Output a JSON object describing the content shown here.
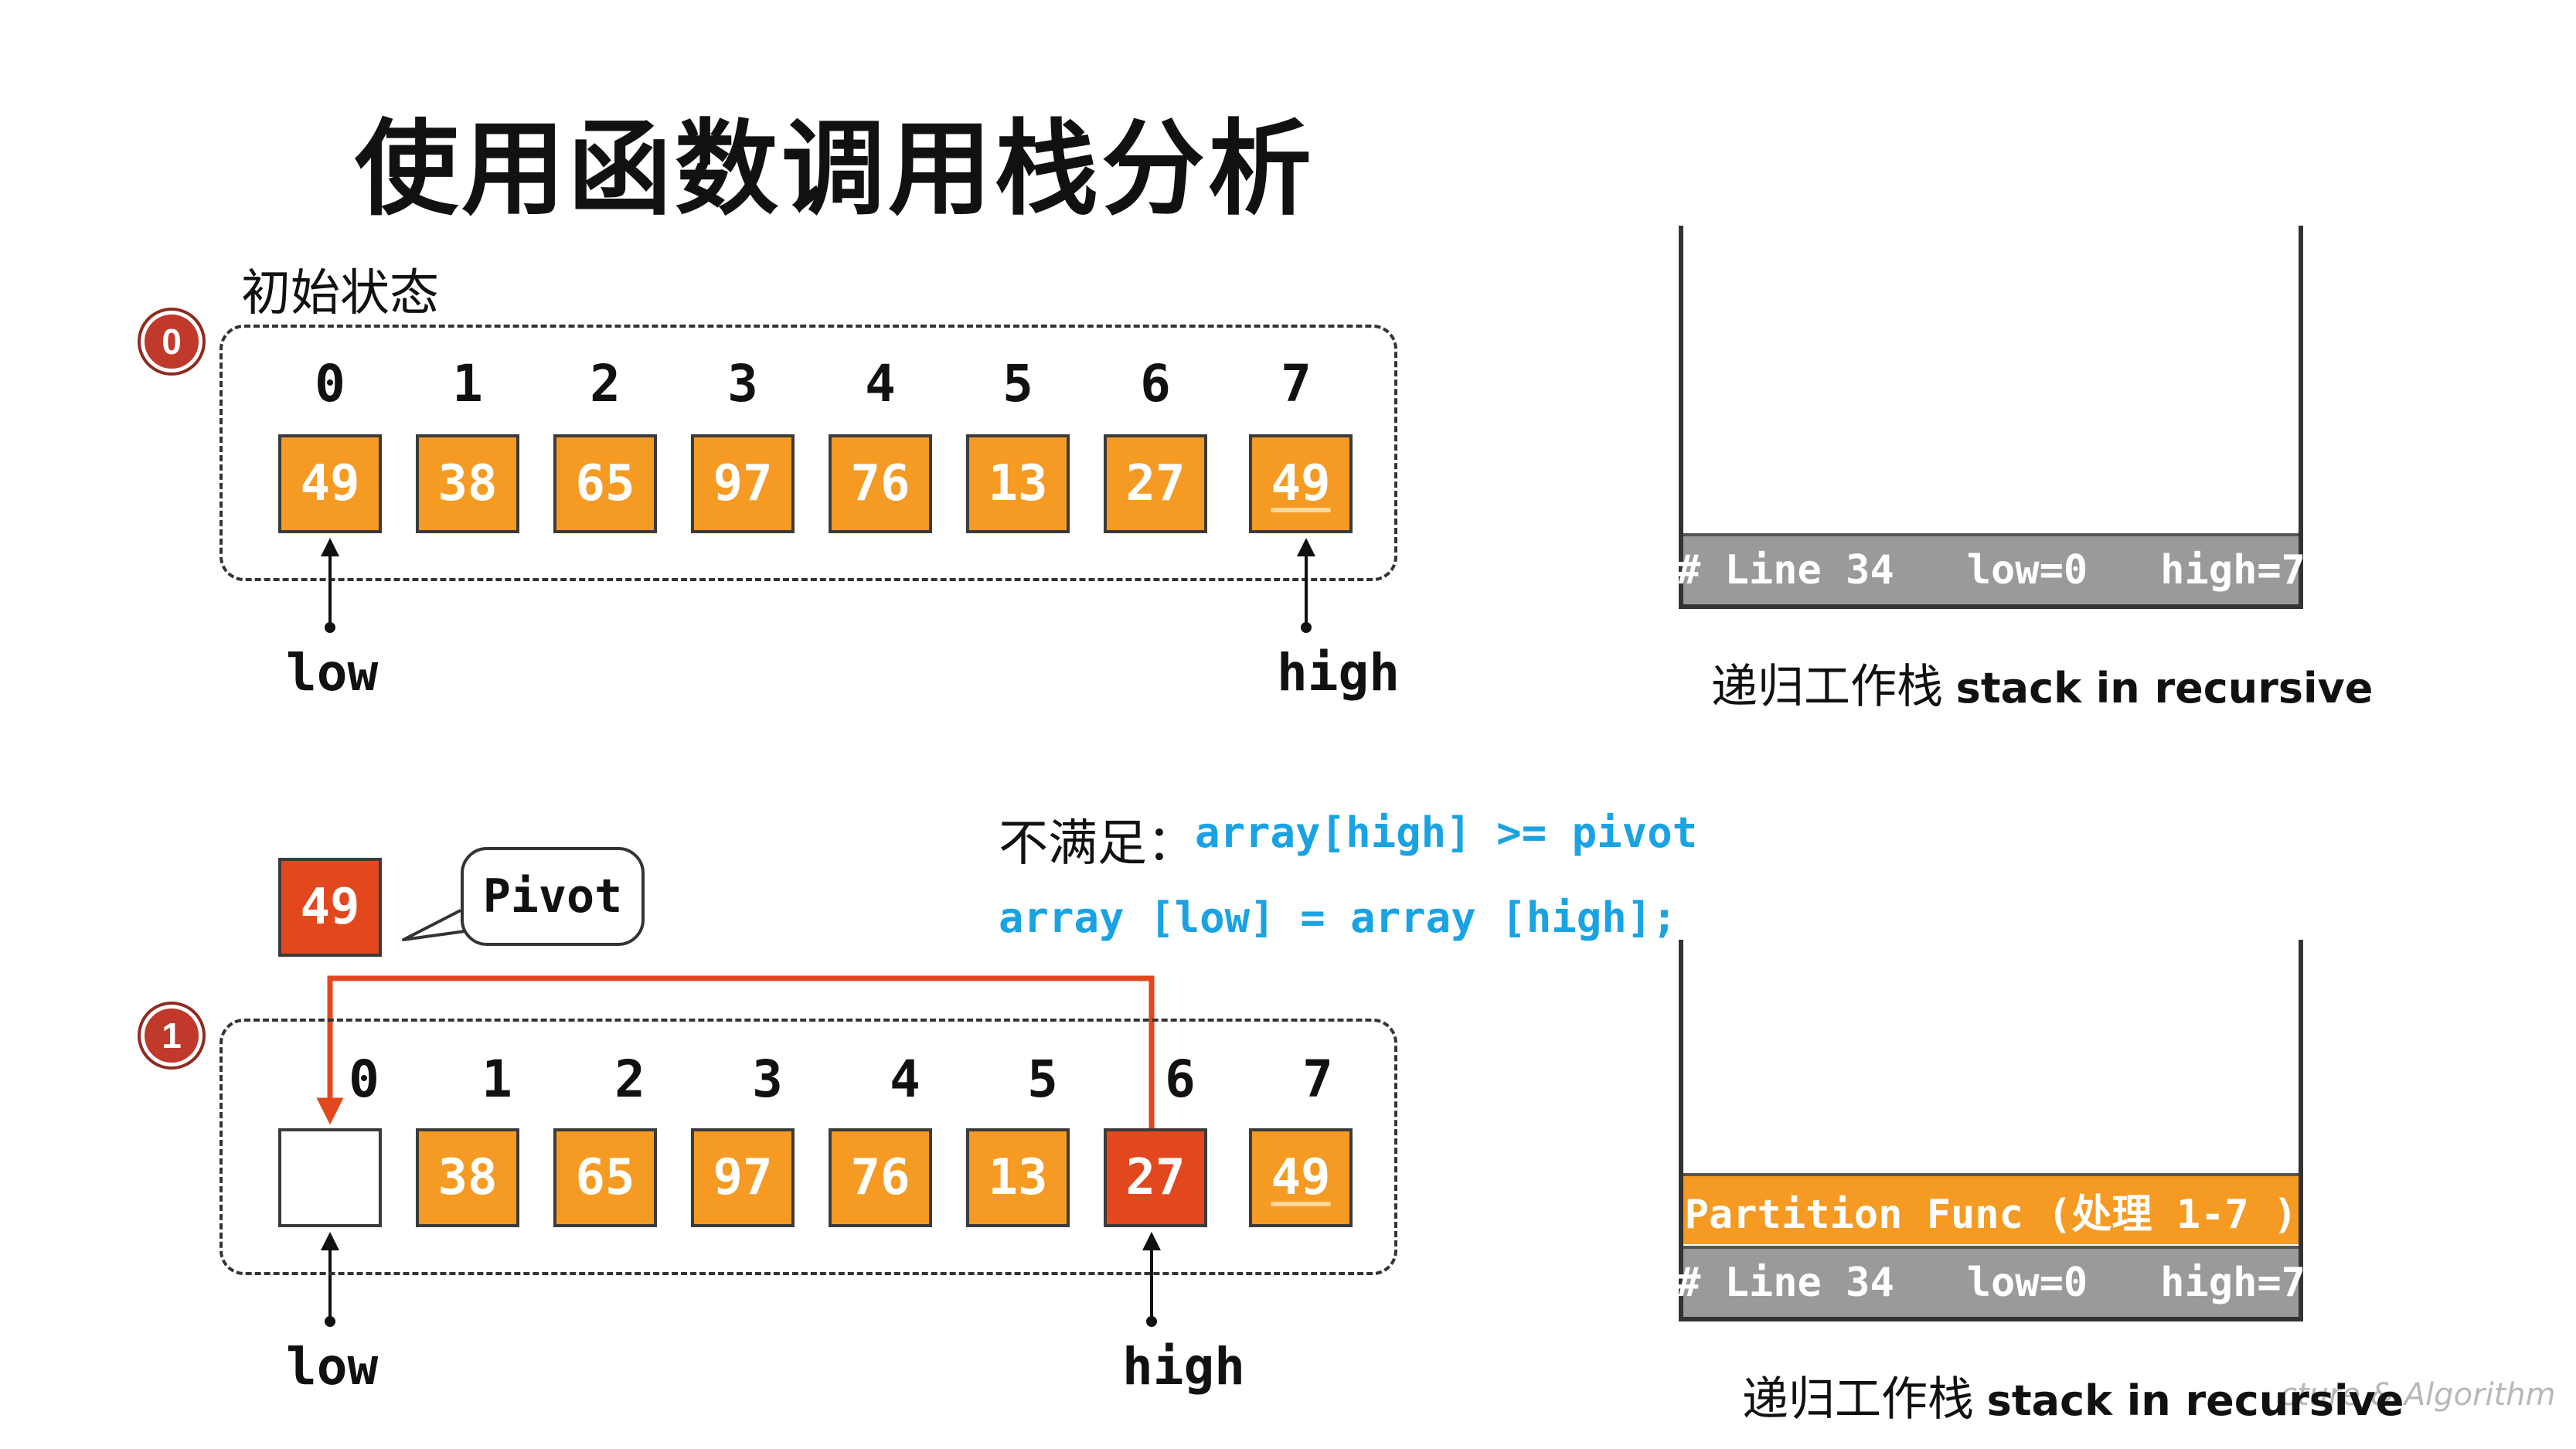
{
  "title": "使用函数调用栈分析",
  "initial_label": "初始状态",
  "panels": [
    {
      "step": "0",
      "indices": [
        "0",
        "1",
        "2",
        "3",
        "4",
        "5",
        "6",
        "7"
      ],
      "cells": [
        {
          "value": "49",
          "style": "orange"
        },
        {
          "value": "38",
          "style": "orange"
        },
        {
          "value": "65",
          "style": "orange"
        },
        {
          "value": "97",
          "style": "orange"
        },
        {
          "value": "76",
          "style": "orange"
        },
        {
          "value": "13",
          "style": "orange"
        },
        {
          "value": "27",
          "style": "orange"
        },
        {
          "value": "49",
          "style": "orange"
        }
      ],
      "low_label": "low",
      "high_label": "high"
    },
    {
      "step": "1",
      "indices": [
        "0",
        "1",
        "2",
        "3",
        "4",
        "5",
        "6",
        "7"
      ],
      "cells": [
        {
          "value": "",
          "style": "empty"
        },
        {
          "value": "38",
          "style": "orange"
        },
        {
          "value": "65",
          "style": "orange"
        },
        {
          "value": "97",
          "style": "orange"
        },
        {
          "value": "76",
          "style": "orange"
        },
        {
          "value": "13",
          "style": "orange"
        },
        {
          "value": "27",
          "style": "red"
        },
        {
          "value": "49",
          "style": "orange"
        }
      ],
      "low_label": "low",
      "high_label": "high"
    }
  ],
  "pivot": {
    "value": "49",
    "label": "Pivot"
  },
  "condition": {
    "prefix": "不满足：",
    "code": "array[high] >= pivot"
  },
  "assignment": "array [low] = array [high];",
  "stacks": [
    {
      "frames": [
        {
          "text": "# Line 34   low=0   high=7",
          "style": "gray"
        }
      ],
      "caption_cn": "递归工作栈",
      "caption_en": "stack in recursive"
    },
    {
      "frames": [
        {
          "text": "Partition Func (处理 1-7 )",
          "style": "orange"
        },
        {
          "text": "# Line 34   low=0   high=7",
          "style": "gray"
        }
      ],
      "caption_cn": "递归工作栈",
      "caption_en": "stack in recursive"
    }
  ],
  "watermark": "cture & Algorithm",
  "colors": {
    "cell_orange": "#f59a23",
    "cell_red": "#e2471d",
    "step_badge": "#c0392b",
    "code_blue": "#1aa3e3",
    "arrow_red": "#e2471d",
    "stack_gray": "#9a9a9a"
  }
}
